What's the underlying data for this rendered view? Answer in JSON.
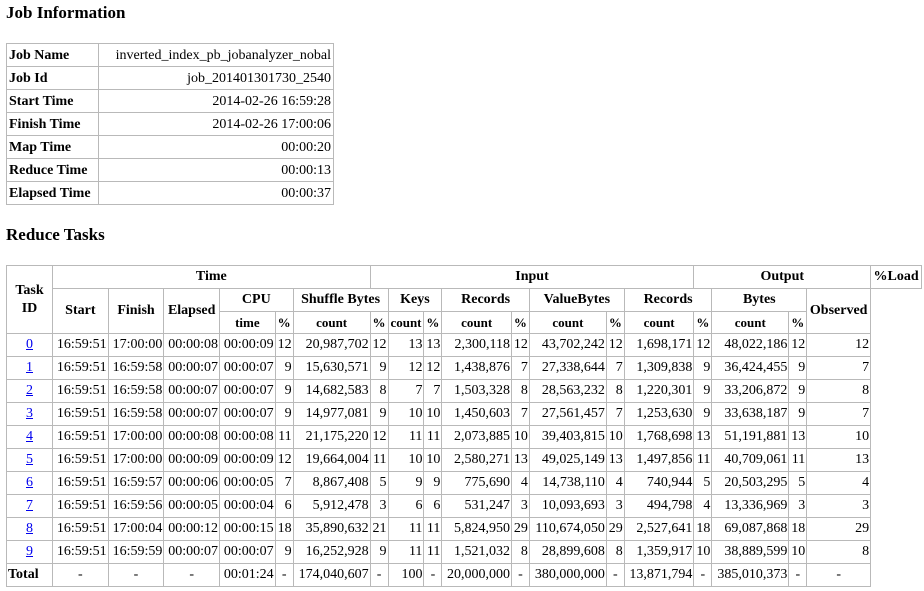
{
  "job_heading": "Job Information",
  "reduce_heading": "Reduce Tasks",
  "job_info": [
    {
      "label": "Job Name",
      "value": "inverted_index_pb_jobanalyzer_nobal"
    },
    {
      "label": "Job Id",
      "value": "job_201401301730_2540"
    },
    {
      "label": "Start Time",
      "value": "2014-02-26 16:59:28"
    },
    {
      "label": "Finish Time",
      "value": "2014-02-26 17:00:06"
    },
    {
      "label": "Map Time",
      "value": "00:00:20"
    },
    {
      "label": "Reduce Time",
      "value": "00:00:13"
    },
    {
      "label": "Elapsed Time",
      "value": "00:00:37"
    }
  ],
  "headers": {
    "task_id": "Task ID",
    "time": "Time",
    "input": "Input",
    "output": "Output",
    "load": "%Load",
    "observed": "Observed",
    "start": "Start",
    "finish": "Finish",
    "elapsed": "Elapsed",
    "cpu": "CPU",
    "shuffle_bytes": "Shuffle Bytes",
    "keys": "Keys",
    "records": "Records",
    "value_bytes": "ValueBytes",
    "out_records": "Records",
    "bytes": "Bytes",
    "time_sub": "time",
    "pct": "%",
    "count": "count"
  },
  "rows": [
    [
      "0",
      "16:59:51",
      "17:00:00",
      "00:00:08",
      "00:00:09",
      "12",
      "20,987,702",
      "12",
      "13",
      "13",
      "2,300,118",
      "12",
      "43,702,242",
      "12",
      "1,698,171",
      "12",
      "48,022,186",
      "12",
      "12"
    ],
    [
      "1",
      "16:59:51",
      "16:59:58",
      "00:00:07",
      "00:00:07",
      "9",
      "15,630,571",
      "9",
      "12",
      "12",
      "1,438,876",
      "7",
      "27,338,644",
      "7",
      "1,309,838",
      "9",
      "36,424,455",
      "9",
      "7"
    ],
    [
      "2",
      "16:59:51",
      "16:59:58",
      "00:00:07",
      "00:00:07",
      "9",
      "14,682,583",
      "8",
      "7",
      "7",
      "1,503,328",
      "8",
      "28,563,232",
      "8",
      "1,220,301",
      "9",
      "33,206,872",
      "9",
      "8"
    ],
    [
      "3",
      "16:59:51",
      "16:59:58",
      "00:00:07",
      "00:00:07",
      "9",
      "14,977,081",
      "9",
      "10",
      "10",
      "1,450,603",
      "7",
      "27,561,457",
      "7",
      "1,253,630",
      "9",
      "33,638,187",
      "9",
      "7"
    ],
    [
      "4",
      "16:59:51",
      "17:00:00",
      "00:00:08",
      "00:00:08",
      "11",
      "21,175,220",
      "12",
      "11",
      "11",
      "2,073,885",
      "10",
      "39,403,815",
      "10",
      "1,768,698",
      "13",
      "51,191,881",
      "13",
      "10"
    ],
    [
      "5",
      "16:59:51",
      "17:00:00",
      "00:00:09",
      "00:00:09",
      "12",
      "19,664,004",
      "11",
      "10",
      "10",
      "2,580,271",
      "13",
      "49,025,149",
      "13",
      "1,497,856",
      "11",
      "40,709,061",
      "11",
      "13"
    ],
    [
      "6",
      "16:59:51",
      "16:59:57",
      "00:00:06",
      "00:00:05",
      "7",
      "8,867,408",
      "5",
      "9",
      "9",
      "775,690",
      "4",
      "14,738,110",
      "4",
      "740,944",
      "5",
      "20,503,295",
      "5",
      "4"
    ],
    [
      "7",
      "16:59:51",
      "16:59:56",
      "00:00:05",
      "00:00:04",
      "6",
      "5,912,478",
      "3",
      "6",
      "6",
      "531,247",
      "3",
      "10,093,693",
      "3",
      "494,798",
      "4",
      "13,336,969",
      "3",
      "3"
    ],
    [
      "8",
      "16:59:51",
      "17:00:04",
      "00:00:12",
      "00:00:15",
      "18",
      "35,890,632",
      "21",
      "11",
      "11",
      "5,824,950",
      "29",
      "110,674,050",
      "29",
      "2,527,641",
      "18",
      "69,087,868",
      "18",
      "29"
    ],
    [
      "9",
      "16:59:51",
      "16:59:59",
      "00:00:07",
      "00:00:07",
      "9",
      "16,252,928",
      "9",
      "11",
      "11",
      "1,521,032",
      "8",
      "28,899,608",
      "8",
      "1,359,917",
      "10",
      "38,889,599",
      "10",
      "8"
    ]
  ],
  "total": [
    "Total",
    "-",
    "-",
    "-",
    "00:01:24",
    "-",
    "174,040,607",
    "-",
    "100",
    "-",
    "20,000,000",
    "-",
    "380,000,000",
    "-",
    "13,871,794",
    "-",
    "385,010,373",
    "-",
    "-"
  ]
}
